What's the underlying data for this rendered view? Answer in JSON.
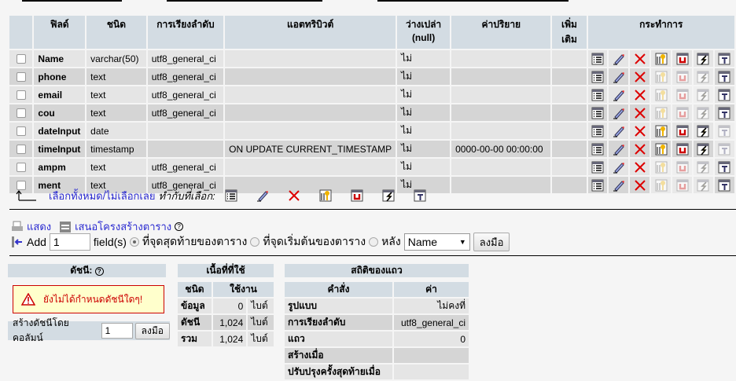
{
  "columns": {
    "field": "ฟิลด์",
    "type": "ชนิด",
    "collation": "การเรียงลำดับ",
    "attributes": "แอตทริบิวต์",
    "null": "ว่างเปล่า (null)",
    "default": "ค่าปริยาย",
    "extra": "เพิ่มเติม",
    "action": "กระทำการ"
  },
  "rows": [
    {
      "field": "Name",
      "type": "varchar(50)",
      "collation": "utf8_general_ci",
      "attributes": "",
      "null": "ไม่",
      "default": "",
      "extra": "",
      "index_enabled": true,
      "fulltext_enabled": true
    },
    {
      "field": "phone",
      "type": "text",
      "collation": "utf8_general_ci",
      "attributes": "",
      "null": "ไม่",
      "default": "",
      "extra": "",
      "index_enabled": false,
      "fulltext_enabled": true
    },
    {
      "field": "email",
      "type": "text",
      "collation": "utf8_general_ci",
      "attributes": "",
      "null": "ไม่",
      "default": "",
      "extra": "",
      "index_enabled": false,
      "fulltext_enabled": true
    },
    {
      "field": "cou",
      "type": "text",
      "collation": "utf8_general_ci",
      "attributes": "",
      "null": "ไม่",
      "default": "",
      "extra": "",
      "index_enabled": false,
      "fulltext_enabled": true
    },
    {
      "field": "dateInput",
      "type": "date",
      "collation": "",
      "attributes": "",
      "null": "ไม่",
      "default": "",
      "extra": "",
      "index_enabled": true,
      "fulltext_enabled": false
    },
    {
      "field": "timeInput",
      "type": "timestamp",
      "collation": "",
      "attributes": "ON UPDATE CURRENT_TIMESTAMP",
      "null": "ไม่",
      "default": "0000-00-00 00:00:00",
      "extra": "",
      "index_enabled": true,
      "fulltext_enabled": false
    },
    {
      "field": "ampm",
      "type": "text",
      "collation": "utf8_general_ci",
      "attributes": "",
      "null": "ไม่",
      "default": "",
      "extra": "",
      "index_enabled": false,
      "fulltext_enabled": true
    },
    {
      "field": "ment",
      "type": "text",
      "collation": "utf8_general_ci",
      "attributes": "",
      "null": "ไม่",
      "default": "",
      "extra": "",
      "index_enabled": false,
      "fulltext_enabled": true
    }
  ],
  "action_icons": [
    "browse-icon",
    "edit-icon",
    "drop-icon",
    "primary-key-icon",
    "unique-icon",
    "index-icon",
    "fulltext-icon"
  ],
  "footer": {
    "check_all": "เลือกทั้งหมด",
    "separator": " / ",
    "uncheck_all": "ไม่เลือกเลย",
    "with_selected": "ทำกับที่เลือก:"
  },
  "links": {
    "print": "แสดง",
    "propose": "เสนอโครงสร้างตาราง"
  },
  "add_field": {
    "add": "Add",
    "count": "1",
    "fields": "field(s)",
    "at_end": "ที่จุดสุดท้ายของตาราง",
    "at_begin": "ที่จุดเริ่มต้นของตาราง",
    "after": "หลัง",
    "after_column": "Name",
    "go": "ลงมือ",
    "selected": "at_end"
  },
  "indexes": {
    "title": "ดัชนี:",
    "warning": "ยังไม่ได้กำหนดดัชนีใดๆ!",
    "create_label": "สร้างดัชนีโดยคอลัมน์",
    "create_count": "1",
    "go": "ลงมือ"
  },
  "space": {
    "title": "เนื้อที่ที่ใช้",
    "h_type": "ชนิด",
    "h_usage": "ใช้งาน",
    "rows": [
      {
        "label": "ข้อมูล",
        "value": "0",
        "unit": "ไบต์"
      },
      {
        "label": "ดัชนี",
        "value": "1,024",
        "unit": "ไบต์"
      },
      {
        "label": "รวม",
        "value": "1,024",
        "unit": "ไบต์"
      }
    ]
  },
  "stats": {
    "title": "สถิติของแถว",
    "h_stmt": "คำสั่ง",
    "h_value": "ค่า",
    "rows": [
      {
        "label": "รูปแบบ",
        "value": "ไม่คงที่"
      },
      {
        "label": "การเรียงลำดับ",
        "value": "utf8_general_ci"
      },
      {
        "label": "แถว",
        "value": "0"
      },
      {
        "label": "สร้างเมื่อ",
        "value": ""
      },
      {
        "label": "ปรับปรุงครั้งสุดท้ายเมื่อ",
        "value": ""
      }
    ]
  }
}
